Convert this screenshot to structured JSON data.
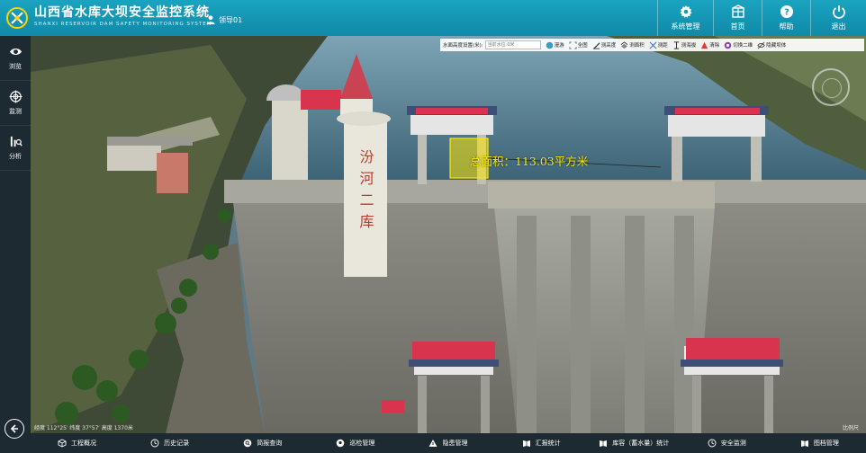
{
  "header": {
    "title": "山西省水库大坝安全监控系统",
    "subtitle": "SHANXI RESERVOIR DAM SAFETY MONITORING SYSTEM",
    "user": "领导01",
    "nav": [
      {
        "label": "系统管理",
        "icon": "gear-icon"
      },
      {
        "label": "首页",
        "icon": "home-icon"
      },
      {
        "label": "帮助",
        "icon": "help-icon"
      },
      {
        "label": "退出",
        "icon": "power-icon"
      }
    ]
  },
  "sidebar": {
    "items": [
      {
        "label": "浏览",
        "icon": "eye-icon"
      },
      {
        "label": "监测",
        "icon": "crosshair-icon"
      },
      {
        "label": "分析",
        "icon": "chart-icon"
      }
    ],
    "back_icon": "back-arrow-icon"
  },
  "toolbar": {
    "water_label": "水面高度设置(米):",
    "water_placeholder": "当前水位:0米",
    "buttons": [
      {
        "label": "漫游",
        "icon": "globe-icon"
      },
      {
        "label": "全图",
        "icon": "full-extent-icon"
      },
      {
        "label": "测高度",
        "icon": "measure-height-icon"
      },
      {
        "label": "测面积",
        "icon": "measure-area-icon"
      },
      {
        "label": "测距",
        "icon": "measure-distance-icon"
      },
      {
        "label": "测海拔",
        "icon": "measure-altitude-icon"
      },
      {
        "label": "清除",
        "icon": "clear-icon"
      },
      {
        "label": "切换二维",
        "icon": "switch-2d-icon"
      },
      {
        "label": "隐藏坝体",
        "icon": "hide-dam-icon"
      }
    ]
  },
  "scene": {
    "area_label": "总面积：113.03平方米",
    "tower_text": "汾河二库",
    "coords_left": "经度 112°25′ 纬度 37°57′  高度 1370米",
    "coords_right": "比例尺"
  },
  "bottom_nav": [
    {
      "label": "工程概况",
      "icon": "cube-icon"
    },
    {
      "label": "历史记录",
      "icon": "history-icon"
    },
    {
      "label": "简报查询",
      "icon": "search-icon"
    },
    {
      "label": "巡检管理",
      "icon": "location-icon"
    },
    {
      "label": "隐患管理",
      "icon": "warning-icon"
    },
    {
      "label": "汇报统计",
      "icon": "book-icon"
    },
    {
      "label": "库容（蓄水量）统计",
      "icon": "book-icon"
    },
    {
      "label": "安全监测",
      "icon": "history-icon"
    },
    {
      "label": "图档管理",
      "icon": "book-icon"
    }
  ],
  "colors": {
    "header": "#129bb8",
    "sidebar": "#1e2a31",
    "area_label": "#ffe600",
    "roof_red": "#d8344d"
  }
}
